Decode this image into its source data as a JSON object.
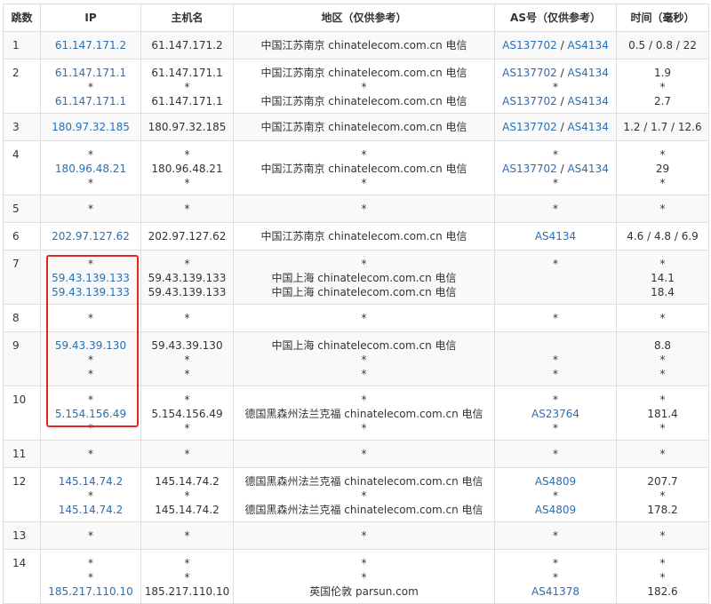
{
  "headers": {
    "hop": "跳数",
    "ip": "IP",
    "host": "主机名",
    "region": "地区（仅供参考）",
    "as": "AS号（仅供参考）",
    "time": "时间（毫秒）"
  },
  "rows": [
    {
      "hop": "1",
      "h": 30,
      "ip": [
        "61.147.171.2"
      ],
      "host": [
        "61.147.171.2"
      ],
      "region": [
        "中国江苏南京 chinatelecom.com.cn 电信"
      ],
      "as": [
        [
          {
            "t": "AS137702",
            "l": true
          },
          {
            "t": " / ",
            "l": false
          },
          {
            "t": "AS4134",
            "l": true
          }
        ]
      ],
      "time": [
        "0.5 / 0.8 / 22"
      ]
    },
    {
      "hop": "2",
      "h": 60,
      "ip": [
        "61.147.171.1",
        "*",
        "61.147.171.1"
      ],
      "host": [
        "61.147.171.1",
        "*",
        "61.147.171.1"
      ],
      "region": [
        "中国江苏南京 chinatelecom.com.cn 电信",
        "*",
        "中国江苏南京 chinatelecom.com.cn 电信"
      ],
      "as": [
        [
          {
            "t": "AS137702",
            "l": true
          },
          {
            "t": " / ",
            "l": false
          },
          {
            "t": "AS4134",
            "l": true
          }
        ],
        [
          {
            "t": "*",
            "l": false
          }
        ],
        [
          {
            "t": "AS137702",
            "l": true
          },
          {
            "t": " / ",
            "l": false
          },
          {
            "t": "AS4134",
            "l": true
          }
        ]
      ],
      "time": [
        "1.9",
        "*",
        "2.7"
      ]
    },
    {
      "hop": "3",
      "h": 30,
      "ip": [
        "180.97.32.185"
      ],
      "host": [
        "180.97.32.185"
      ],
      "region": [
        "中国江苏南京 chinatelecom.com.cn 电信"
      ],
      "as": [
        [
          {
            "t": "AS137702",
            "l": true
          },
          {
            "t": " / ",
            "l": false
          },
          {
            "t": "AS4134",
            "l": true
          }
        ]
      ],
      "time": [
        "1.2 / 1.7 / 12.6"
      ]
    },
    {
      "hop": "4",
      "h": 60,
      "ip": [
        "*",
        "180.96.48.21",
        "*"
      ],
      "host": [
        "*",
        "180.96.48.21",
        "*"
      ],
      "region": [
        "*",
        "中国江苏南京 chinatelecom.com.cn 电信",
        "*"
      ],
      "as": [
        [
          {
            "t": "*",
            "l": false
          }
        ],
        [
          {
            "t": "AS137702",
            "l": true
          },
          {
            "t": " / ",
            "l": false
          },
          {
            "t": "AS4134",
            "l": true
          }
        ],
        [
          {
            "t": "*",
            "l": false
          }
        ]
      ],
      "time": [
        "*",
        "29",
        "*"
      ]
    },
    {
      "hop": "5",
      "h": 30,
      "ip": [
        "*"
      ],
      "host": [
        "*"
      ],
      "region": [
        "*"
      ],
      "as": [
        [
          {
            "t": "*",
            "l": false
          }
        ]
      ],
      "time": [
        "*"
      ]
    },
    {
      "hop": "6",
      "h": 30,
      "ip": [
        "202.97.127.62"
      ],
      "host": [
        "202.97.127.62"
      ],
      "region": [
        "中国江苏南京 chinatelecom.com.cn 电信"
      ],
      "as": [
        [
          {
            "t": "AS4134",
            "l": true
          }
        ]
      ],
      "time": [
        "4.6 / 4.8 / 6.9"
      ]
    },
    {
      "hop": "7",
      "h": 60,
      "ip": [
        "*",
        "59.43.139.133",
        "59.43.139.133"
      ],
      "host": [
        "*",
        "59.43.139.133",
        "59.43.139.133"
      ],
      "region": [
        "*",
        "中国上海 chinatelecom.com.cn 电信",
        "中国上海 chinatelecom.com.cn 电信"
      ],
      "as": [
        [
          {
            "t": "*",
            "l": false
          }
        ],
        [
          {
            "t": "",
            "l": false
          }
        ],
        [
          {
            "t": "",
            "l": false
          }
        ]
      ],
      "time": [
        "*",
        "14.1",
        "18.4"
      ]
    },
    {
      "hop": "8",
      "h": 30,
      "ip": [
        "*"
      ],
      "host": [
        "*"
      ],
      "region": [
        "*"
      ],
      "as": [
        [
          {
            "t": "*",
            "l": false
          }
        ]
      ],
      "time": [
        "*"
      ]
    },
    {
      "hop": "9",
      "h": 60,
      "ip": [
        "59.43.39.130",
        "*",
        "*"
      ],
      "host": [
        "59.43.39.130",
        "*",
        "*"
      ],
      "region": [
        "中国上海 chinatelecom.com.cn 电信",
        "*",
        "*"
      ],
      "as": [
        [
          {
            "t": "",
            "l": false
          }
        ],
        [
          {
            "t": "*",
            "l": false
          }
        ],
        [
          {
            "t": "*",
            "l": false
          }
        ]
      ],
      "time": [
        "8.8",
        "*",
        "*"
      ]
    },
    {
      "hop": "10",
      "h": 60,
      "ip": [
        "*",
        "5.154.156.49",
        "*"
      ],
      "host": [
        "*",
        "5.154.156.49",
        "*"
      ],
      "region": [
        "*",
        "德国黑森州法兰克福 chinatelecom.com.cn 电信",
        "*"
      ],
      "as": [
        [
          {
            "t": "*",
            "l": false
          }
        ],
        [
          {
            "t": "AS23764",
            "l": true
          }
        ],
        [
          {
            "t": "*",
            "l": false
          }
        ]
      ],
      "time": [
        "*",
        "181.4",
        "*"
      ]
    },
    {
      "hop": "11",
      "h": 30,
      "ip": [
        "*"
      ],
      "host": [
        "*"
      ],
      "region": [
        "*"
      ],
      "as": [
        [
          {
            "t": "*",
            "l": false
          }
        ]
      ],
      "time": [
        "*"
      ]
    },
    {
      "hop": "12",
      "h": 60,
      "ip": [
        "145.14.74.2",
        "*",
        "145.14.74.2"
      ],
      "host": [
        "145.14.74.2",
        "*",
        "145.14.74.2"
      ],
      "region": [
        "德国黑森州法兰克福 chinatelecom.com.cn 电信",
        "*",
        "德国黑森州法兰克福 chinatelecom.com.cn 电信"
      ],
      "as": [
        [
          {
            "t": "AS4809",
            "l": true
          }
        ],
        [
          {
            "t": "*",
            "l": false
          }
        ],
        [
          {
            "t": "AS4809",
            "l": true
          }
        ]
      ],
      "time": [
        "207.7",
        "*",
        "178.2"
      ]
    },
    {
      "hop": "13",
      "h": 30,
      "ip": [
        "*"
      ],
      "host": [
        "*"
      ],
      "region": [
        "*"
      ],
      "as": [
        [
          {
            "t": "*",
            "l": false
          }
        ]
      ],
      "time": [
        "*"
      ]
    },
    {
      "hop": "14",
      "h": 60,
      "ip": [
        "*",
        "*",
        "185.217.110.10"
      ],
      "host": [
        "*",
        "*",
        "185.217.110.10"
      ],
      "region": [
        "*",
        "*",
        "英国伦敦 parsun.com"
      ],
      "as": [
        [
          {
            "t": "*",
            "l": false
          }
        ],
        [
          {
            "t": "*",
            "l": false
          }
        ],
        [
          {
            "t": "AS41378",
            "l": true
          }
        ]
      ],
      "time": [
        "*",
        "*",
        "182.6"
      ]
    }
  ],
  "colors": {
    "link": "#2a6fb5",
    "highlight": "#e02525",
    "border": "#dedede",
    "stripe": "#f9f9f9"
  }
}
